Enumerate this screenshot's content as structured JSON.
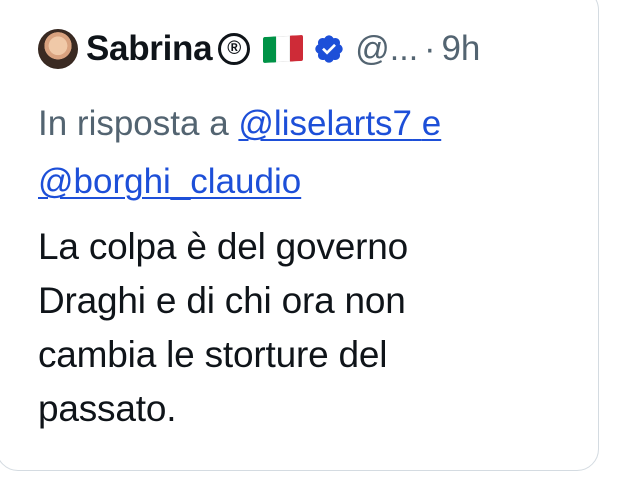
{
  "tweet": {
    "display_name": "Sabrina",
    "registered_mark": "®",
    "handle": "@...",
    "separator": "·",
    "time": "9h",
    "reply_prefix": "In risposta a",
    "reply_mentions": [
      "@liselarts7",
      "e",
      "@borghi_claudio"
    ],
    "text_lines": [
      "La colpa è del governo",
      "Draghi e di chi ora non",
      "cambia le storture del",
      "passato."
    ]
  },
  "icons": {
    "avatar": "profile-photo",
    "flag": "italy-flag-icon",
    "verified": "verified-badge-icon",
    "registered": "registered-mark-icon"
  },
  "colors": {
    "text_primary": "#0f1419",
    "text_secondary": "#536471",
    "mention_link": "#1d4fd8",
    "verified_blue": "#1d4fd8",
    "border": "#d4dbe1",
    "flag_green": "#009246",
    "flag_white": "#ffffff",
    "flag_red": "#ce2b37"
  }
}
